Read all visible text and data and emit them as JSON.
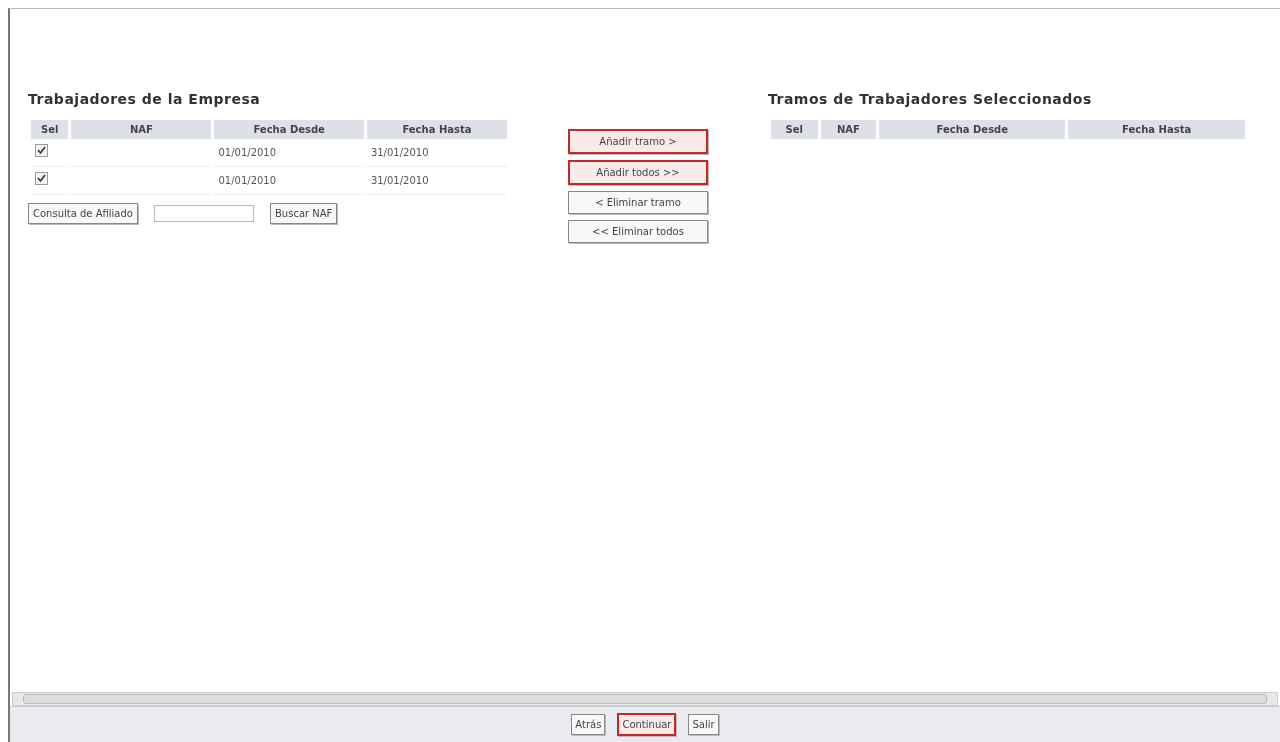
{
  "left_panel": {
    "title": "Trabajadores de la Empresa",
    "columns": [
      "Sel",
      "NAF",
      "Fecha Desde",
      "Fecha Hasta"
    ],
    "rows": [
      {
        "checked": true,
        "naf": "",
        "fecha_desde": "01/01/2010",
        "fecha_hasta": "31/01/2010"
      },
      {
        "checked": true,
        "naf": "",
        "fecha_desde": "01/01/2010",
        "fecha_hasta": "31/01/2010"
      }
    ],
    "consulta_button": "Consulta de Afiliado",
    "buscar_button": "Buscar NAF"
  },
  "transfer_buttons": [
    {
      "label": "Añadir tramo >",
      "highlighted": true
    },
    {
      "label": "Añadir todos >>",
      "highlighted": true
    },
    {
      "label": "< Eliminar tramo",
      "highlighted": false
    },
    {
      "label": "<< Eliminar todos",
      "highlighted": false
    }
  ],
  "right_panel": {
    "title": "Tramos de Trabajadores Seleccionados",
    "columns": [
      "Sel",
      "NAF",
      "Fecha Desde",
      "Fecha Hasta"
    ]
  },
  "footer_buttons": [
    {
      "label": "Atrás",
      "highlighted": false
    },
    {
      "label": "Continuar",
      "highlighted": true
    },
    {
      "label": "Salir",
      "highlighted": false
    }
  ]
}
